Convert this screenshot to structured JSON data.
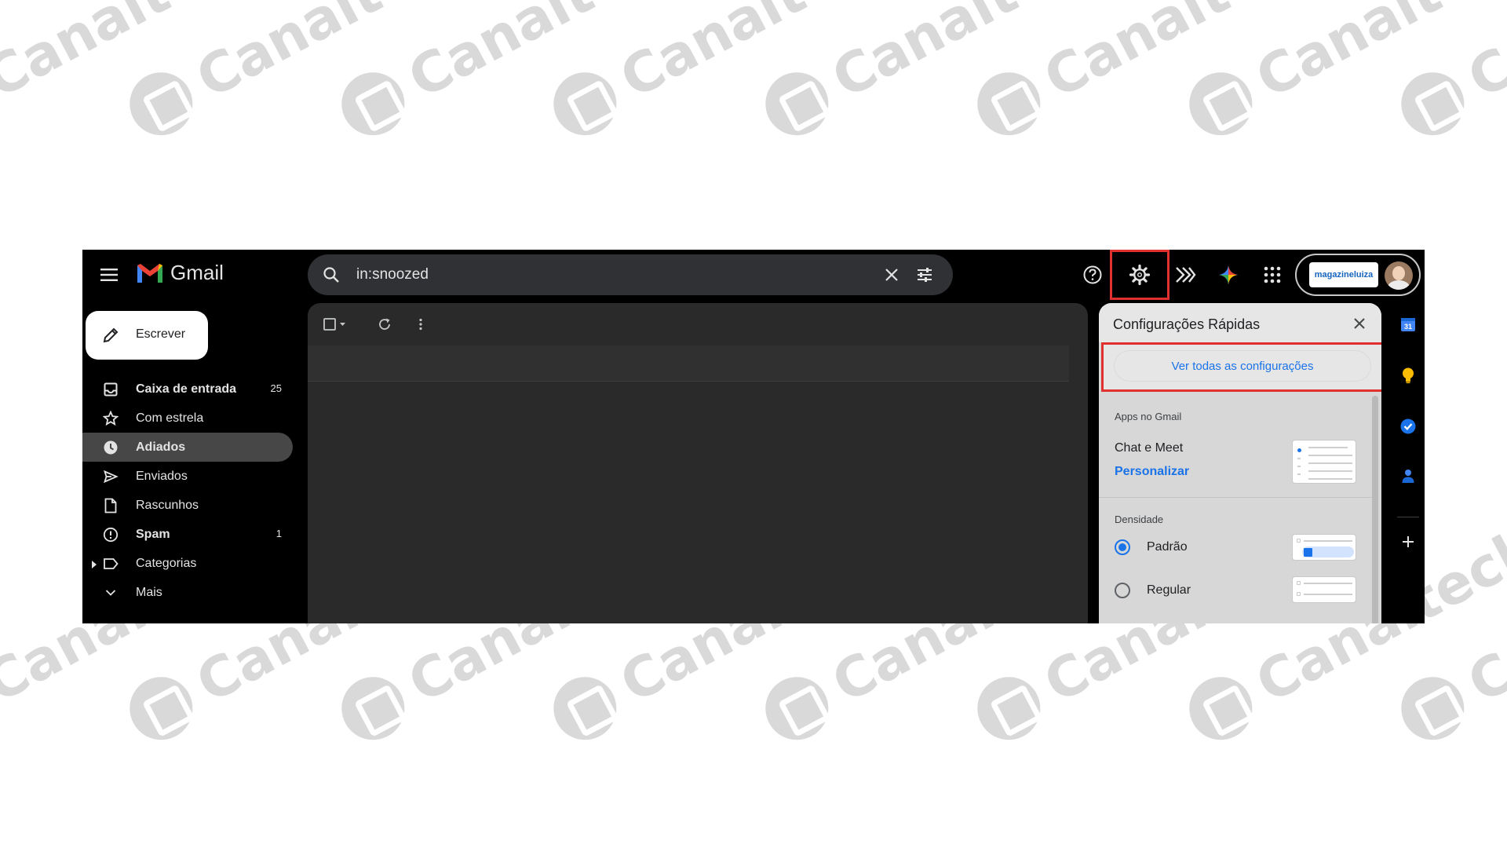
{
  "header": {
    "app_name": "Gmail",
    "search_value": "in:snoozed",
    "account_brand": "magazineluiza"
  },
  "sidebar": {
    "compose_label": "Escrever",
    "items": [
      {
        "label": "Caixa de entrada",
        "count": "25"
      },
      {
        "label": "Com estrela",
        "count": ""
      },
      {
        "label": "Adiados",
        "count": ""
      },
      {
        "label": "Enviados",
        "count": ""
      },
      {
        "label": "Rascunhos",
        "count": ""
      },
      {
        "label": "Spam",
        "count": "1"
      },
      {
        "label": "Categorias",
        "count": ""
      },
      {
        "label": "Mais",
        "count": ""
      }
    ]
  },
  "quick_settings": {
    "title": "Configurações Rápidas",
    "see_all_label": "Ver todas as configurações",
    "apps_section": "Apps no Gmail",
    "chat_meet": "Chat e Meet",
    "customize_link": "Personalizar",
    "density_section": "Densidade",
    "density_options": [
      {
        "label": "Padrão",
        "selected": true
      },
      {
        "label": "Regular",
        "selected": false
      }
    ]
  },
  "watermark": {
    "text": "Canaltech"
  },
  "colors": {
    "accent_blue": "#1a73e8",
    "highlight_red": "#e03030",
    "app_background": "#000000",
    "panel_background": "#2a2a2a"
  }
}
